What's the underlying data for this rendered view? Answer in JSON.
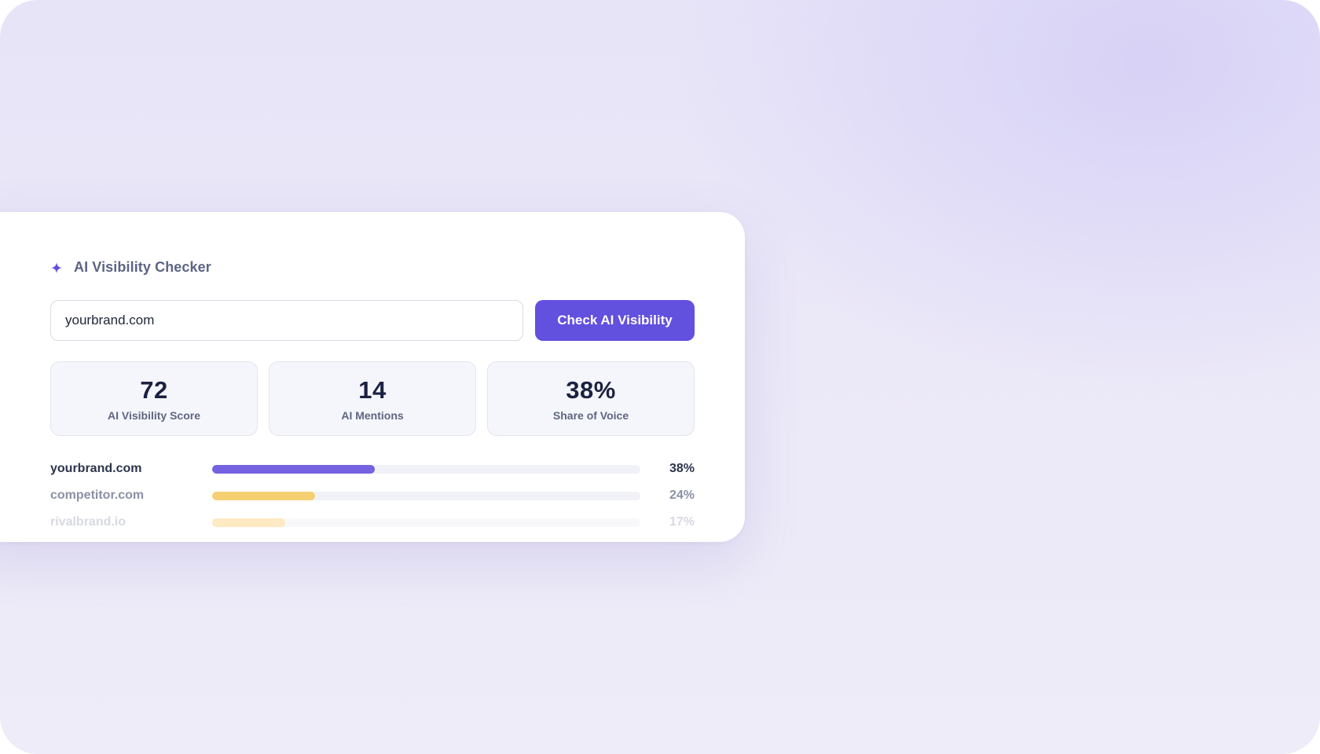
{
  "widget": {
    "title": "AI Visibility Checker",
    "icon": "sparkle-icon",
    "accent_color": "#6250de",
    "input": {
      "value": "yourbrand.com",
      "placeholder": ""
    },
    "button_label": "Check AI Visibility"
  },
  "stats": [
    {
      "value": "72",
      "label": "AI Visibility Score"
    },
    {
      "value": "14",
      "label": "AI Mentions"
    },
    {
      "value": "38%",
      "label": "Share of Voice"
    }
  ],
  "share_rows": [
    {
      "domain": "yourbrand.com",
      "percent_label": "38%",
      "share": 0.38,
      "color": "#7462e0"
    },
    {
      "domain": "competitor.com",
      "percent_label": "24%",
      "share": 0.24,
      "color": "#f5d072"
    },
    {
      "domain": "rivalbrand.io",
      "percent_label": "17%",
      "share": 0.17,
      "color": "#fde9c2"
    }
  ]
}
